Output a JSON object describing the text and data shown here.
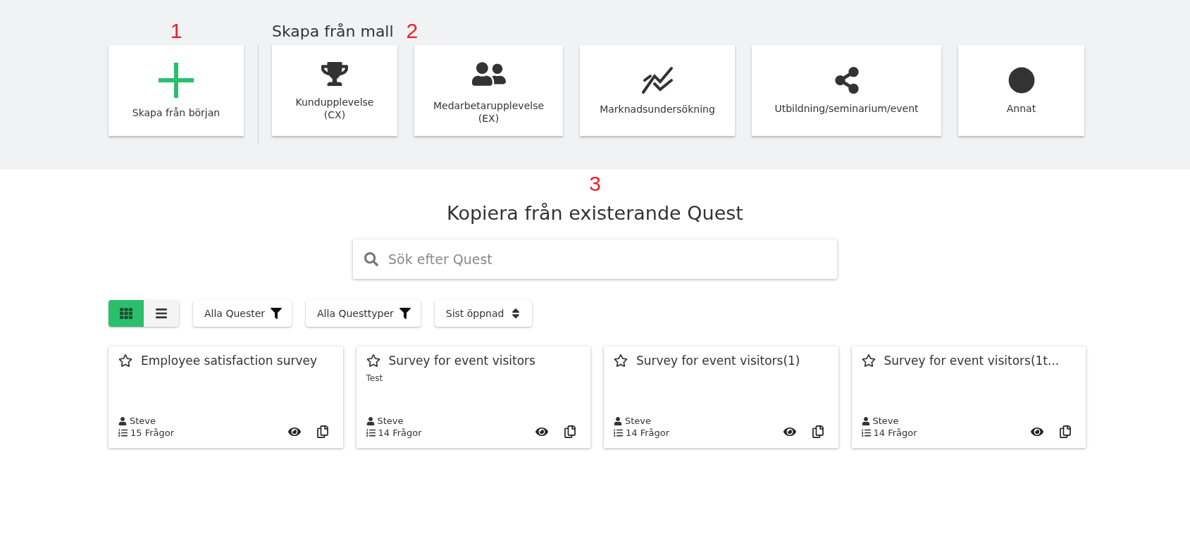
{
  "start": {
    "marker": "1",
    "label": "Skapa från början"
  },
  "templates": {
    "marker": "2",
    "heading": "Skapa från mall",
    "items": [
      {
        "kind": "trophy",
        "lines": [
          "Kundupplevelse",
          "(CX)"
        ]
      },
      {
        "kind": "people",
        "lines": [
          "Medarbetarupplevelse",
          "(EX)"
        ]
      },
      {
        "kind": "chart",
        "lines": [
          "Marknadsundersökning"
        ]
      },
      {
        "kind": "share",
        "lines": [
          "Utbildning/seminarium/event"
        ]
      },
      {
        "kind": "dot",
        "lines": [
          "Annat"
        ]
      }
    ]
  },
  "copy": {
    "marker": "3",
    "title": "Kopiera från existerande Quest",
    "search": {
      "placeholder": "Sök efter Quest"
    },
    "view_toggle": [
      {
        "kind": "grid",
        "selected": true
      },
      {
        "kind": "list",
        "selected": false
      }
    ],
    "filters": [
      {
        "kind": "filter",
        "label": "Alla Quester"
      },
      {
        "kind": "filter",
        "label": "Alla Questtyper"
      },
      {
        "kind": "sort",
        "label": "Sist öppnad"
      }
    ],
    "quests": [
      {
        "title": "Employee satisfaction survey",
        "starred": false,
        "author": "Steve",
        "questions": "15 Frågor"
      },
      {
        "title": "Survey for event visitors",
        "description": "Test",
        "starred": false,
        "author": "Steve",
        "questions": "14 Frågor"
      },
      {
        "title": "Survey for event visitors(1)",
        "starred": false,
        "author": "Steve",
        "questions": "14 Frågor"
      },
      {
        "title": "Survey for event visitors(1t...",
        "starred": false,
        "author": "Steve",
        "questions": "14 Frågor"
      }
    ]
  }
}
